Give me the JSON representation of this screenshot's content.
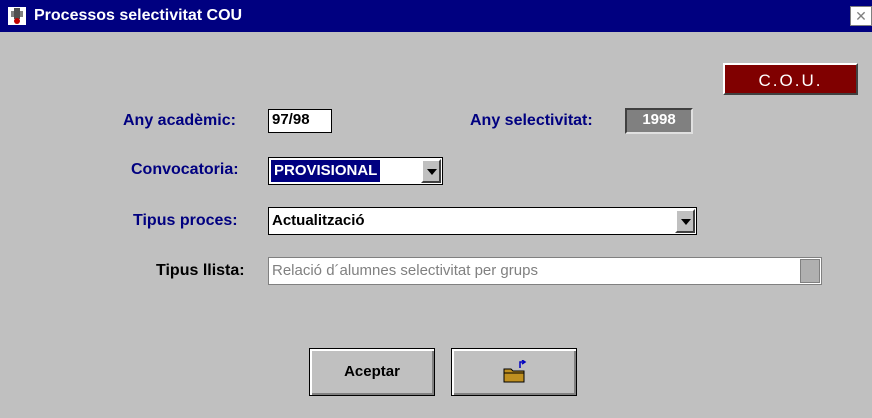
{
  "window": {
    "title": "Processos selectivitat COU",
    "close_symbol": "✕",
    "app_icon": "selectivitat-app-icon"
  },
  "badge": {
    "text": "C.O.U.",
    "color": "#800000"
  },
  "fields": {
    "any_academic": {
      "label": "Any acadèmic:",
      "value": "97/98"
    },
    "any_selectivitat": {
      "label": "Any selectivitat:",
      "value": "1998"
    },
    "convocatoria": {
      "label": "Convocatoria:",
      "value": "PROVISIONAL"
    },
    "tipus_proces": {
      "label": "Tipus proces:",
      "value": "Actualització"
    },
    "tipus_llista": {
      "label": "Tipus llista:",
      "value": "Relació d´alumnes selectivitat per grups"
    }
  },
  "buttons": {
    "accept": {
      "label": "Aceptar"
    },
    "exit": {
      "icon": "folder-exit-icon"
    }
  },
  "colors": {
    "titlebar": "#000080",
    "label": "#000080",
    "selection": "#000080",
    "window_bg": "#c0c0c0"
  }
}
